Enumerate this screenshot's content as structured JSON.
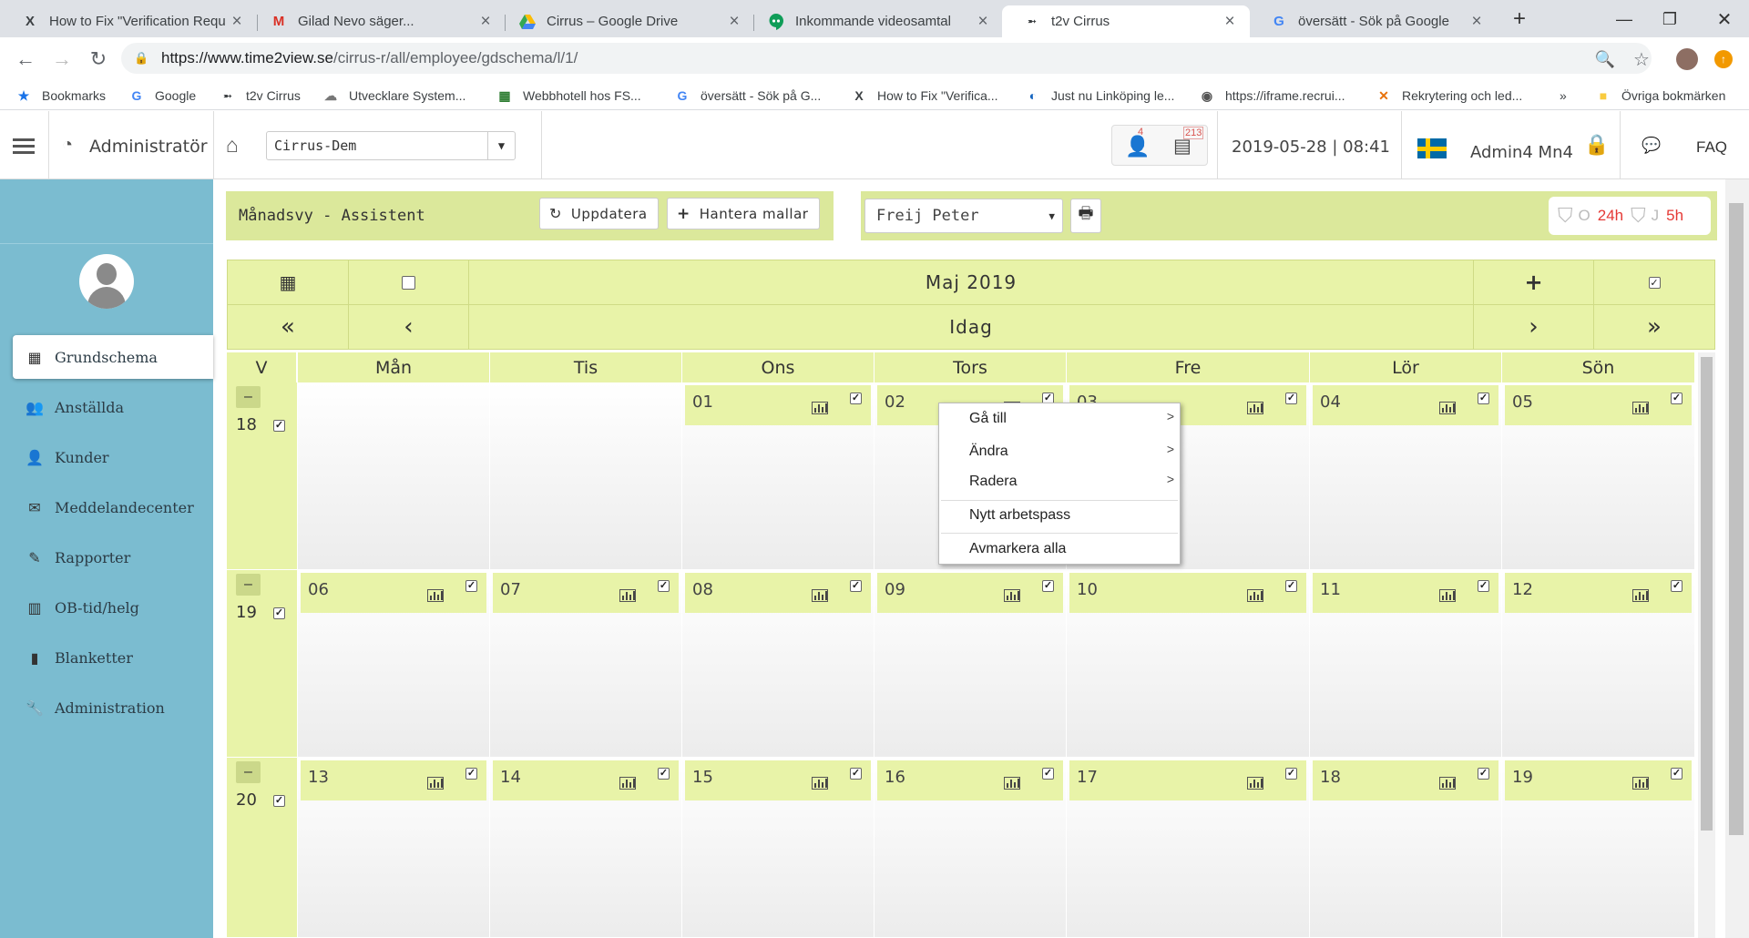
{
  "browser": {
    "tabs": [
      {
        "title": "How to Fix \"Verification Requ",
        "icon": "x-favicon-icon"
      },
      {
        "title": "Gilad Nevo säger...",
        "icon": "gmail-icon"
      },
      {
        "title": "Cirrus – Google Drive",
        "icon": "drive-icon"
      },
      {
        "title": "Inkommande videosamtal",
        "icon": "hangouts-icon"
      },
      {
        "title": "t2v Cirrus",
        "icon": "t2v-icon"
      },
      {
        "title": "översätt - Sök på Google",
        "icon": "google-icon"
      }
    ],
    "url_host": "https://www.time2view.se",
    "url_path": "/cirrus-r/all/employee/gdschema/l/1/",
    "bookmarks": [
      "Bookmarks",
      "Google",
      "t2v Cirrus",
      "Utvecklare System...",
      "Webbhotell hos FS...",
      "översätt - Sök på G...",
      "How to Fix \"Verifica...",
      "Just nu Linköping le...",
      "https://iframe.recrui...",
      "Rekrytering och led..."
    ],
    "bookmarks_more": "»",
    "other_bookmarks": "Övriga bokmärken"
  },
  "header": {
    "role": "Administratör",
    "org_select": "Cirrus-Dem",
    "badge_users": "4",
    "badge_docs": "213",
    "datetime": "2019-05-28 | 08:41",
    "user": "Admin4 Mn4",
    "faq": "FAQ"
  },
  "sidebar": {
    "items": [
      {
        "label": "Grundschema",
        "icon": "calendar-icon"
      },
      {
        "label": "Anställda",
        "icon": "users-icon"
      },
      {
        "label": "Kunder",
        "icon": "user-icon"
      },
      {
        "label": "Meddelandecenter",
        "icon": "envelope-icon"
      },
      {
        "label": "Rapporter",
        "icon": "pencil-icon"
      },
      {
        "label": "OB-tid/helg",
        "icon": "bar-chart-icon"
      },
      {
        "label": "Blanketter",
        "icon": "file-icon"
      },
      {
        "label": "Administration",
        "icon": "wrench-icon"
      }
    ]
  },
  "toolbar": {
    "view_title": "Månadsvy - Assistent",
    "refresh_label": "Uppdatera",
    "manage_templates_label": "Hantera mallar",
    "employee_select": "Freij Peter",
    "stats": {
      "o_label": "O",
      "o_value": "24h",
      "j_label": "J",
      "j_value": "5h"
    }
  },
  "calendar": {
    "month_title": "Maj 2019",
    "today_label": "Idag",
    "week_header": "V",
    "day_headers": [
      "Mån",
      "Tis",
      "Ons",
      "Tors",
      "Fre",
      "Lör",
      "Sön"
    ],
    "weeks": [
      {
        "week": "18",
        "collapse": "–",
        "days": [
          "",
          "",
          "01",
          "02",
          "03",
          "04",
          "05"
        ]
      },
      {
        "week": "19",
        "collapse": "–",
        "days": [
          "06",
          "07",
          "08",
          "09",
          "10",
          "11",
          "12"
        ]
      },
      {
        "week": "20",
        "collapse": "–",
        "days": [
          "13",
          "14",
          "15",
          "16",
          "17",
          "18",
          "19"
        ]
      }
    ]
  },
  "context_menu": {
    "goto": "Gå till",
    "edit": "Ändra",
    "delete": "Radera",
    "new_shift": "Nytt arbetspass",
    "deselect_all": "Avmarkera alla",
    "arrow": ">"
  }
}
